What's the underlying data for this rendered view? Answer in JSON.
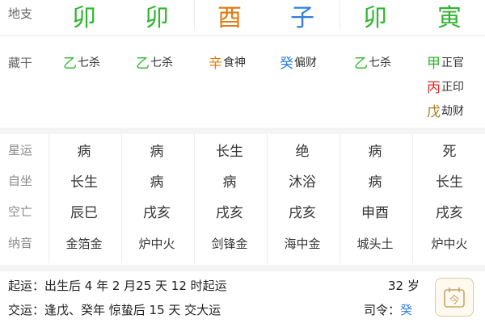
{
  "dizhi": {
    "label": "地支",
    "chars": [
      {
        "char": "卯",
        "color": "#2fb52f"
      },
      {
        "char": "卯",
        "color": "#2fb52f"
      },
      {
        "char": "酉",
        "color": "#e07b12"
      },
      {
        "char": "子",
        "color": "#2f7fe0"
      },
      {
        "char": "卯",
        "color": "#2fb52f"
      },
      {
        "char": "寅",
        "color": "#2fb52f"
      }
    ]
  },
  "canggan": {
    "label": "藏干",
    "columns": [
      [
        {
          "stem": "乙",
          "shen": "七杀",
          "color": "#2fb52f"
        }
      ],
      [
        {
          "stem": "乙",
          "shen": "七杀",
          "color": "#2fb52f"
        }
      ],
      [
        {
          "stem": "辛",
          "shen": "食神",
          "color": "#e07b12"
        }
      ],
      [
        {
          "stem": "癸",
          "shen": "偏财",
          "color": "#2f7fe0"
        }
      ],
      [
        {
          "stem": "乙",
          "shen": "七杀",
          "color": "#2fb52f"
        }
      ],
      [
        {
          "stem": "甲",
          "shen": "正官",
          "color": "#2fb52f"
        },
        {
          "stem": "丙",
          "shen": "正印",
          "color": "#e02b2b"
        },
        {
          "stem": "戊",
          "shen": "劫财",
          "color": "#a67c1e"
        }
      ]
    ]
  },
  "grid": {
    "rows": [
      {
        "label": "星运",
        "cells": [
          "病",
          "病",
          "长生",
          "绝",
          "病",
          "死"
        ]
      },
      {
        "label": "自坐",
        "cells": [
          "长生",
          "病",
          "病",
          "沐浴",
          "病",
          "长生"
        ]
      },
      {
        "label": "空亡",
        "cells": [
          "辰巳",
          "戌亥",
          "戌亥",
          "戌亥",
          "申酉",
          "戌亥"
        ]
      },
      {
        "label": "纳音",
        "cells": [
          "金箔金",
          "炉中火",
          "剑锋金",
          "海中金",
          "城头土",
          "炉中火"
        ]
      }
    ]
  },
  "footer": {
    "qiyun": "起运：出生后 4 年 2 月25 天 12 时起运",
    "jiaoyun": "交运：逢戊、癸年 惊蛰后 15 天 交大运",
    "age": "32 岁",
    "siling_label": "司令：",
    "siling_value": "癸",
    "calendar_icon_text": "今"
  }
}
